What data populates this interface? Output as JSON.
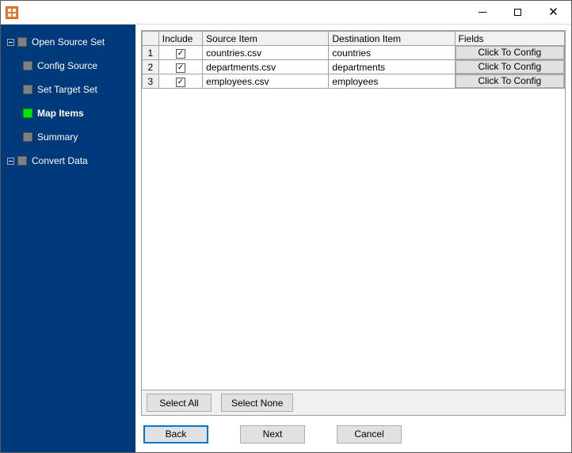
{
  "titlebar": {
    "title": ""
  },
  "sidebar": {
    "items": [
      {
        "label": "Open Source Set",
        "level": 0,
        "expand": true,
        "active": false
      },
      {
        "label": "Config Source",
        "level": 1,
        "expand": false,
        "active": false
      },
      {
        "label": "Set Target Set",
        "level": 1,
        "expand": false,
        "active": false
      },
      {
        "label": "Map Items",
        "level": 1,
        "expand": false,
        "active": true
      },
      {
        "label": "Summary",
        "level": 1,
        "expand": false,
        "active": false
      },
      {
        "label": "Convert Data",
        "level": 0,
        "expand": true,
        "active": false
      }
    ]
  },
  "grid": {
    "headers": {
      "include": "Include",
      "source": "Source Item",
      "dest": "Destination Item",
      "fields": "Fields"
    },
    "fields_button_label": "Click To Config",
    "rows": [
      {
        "num": "1",
        "include": true,
        "source": "countries.csv",
        "dest": "countries"
      },
      {
        "num": "2",
        "include": true,
        "source": "departments.csv",
        "dest": "departments"
      },
      {
        "num": "3",
        "include": true,
        "source": "employees.csv",
        "dest": "employees"
      }
    ]
  },
  "selectbar": {
    "select_all": "Select All",
    "select_none": "Select None"
  },
  "footer": {
    "back": "Back",
    "next": "Next",
    "cancel": "Cancel"
  }
}
